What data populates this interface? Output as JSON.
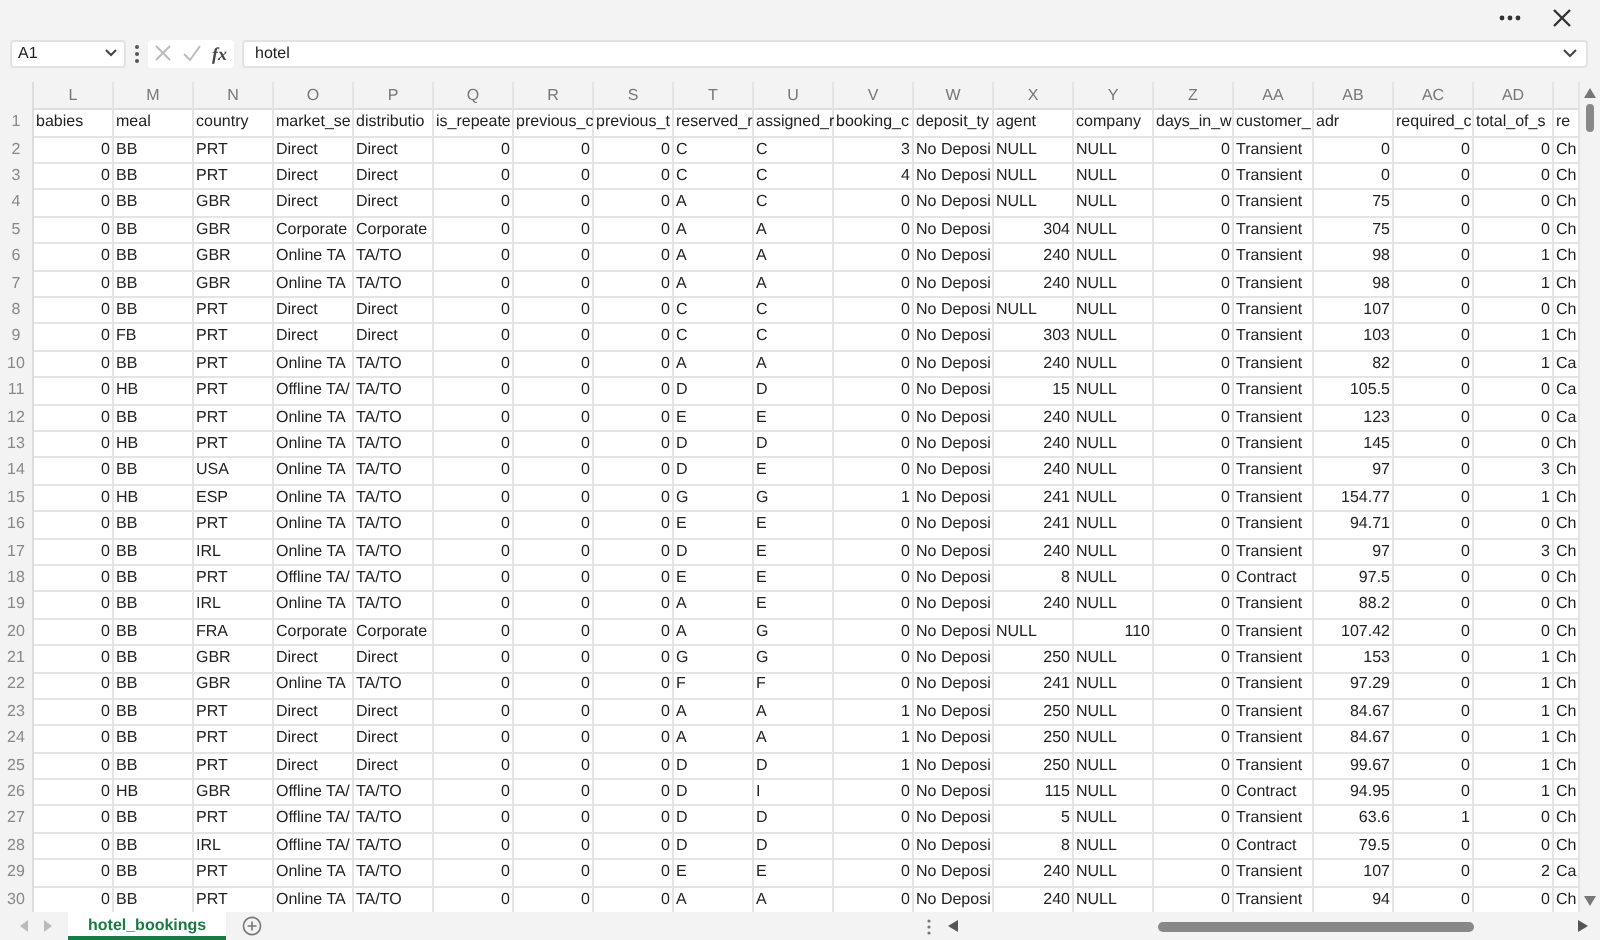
{
  "formula_bar": {
    "name_box": "A1",
    "function_label": "fx",
    "formula": "hotel"
  },
  "sheet": {
    "column_letters": [
      "L",
      "M",
      "N",
      "O",
      "P",
      "Q",
      "R",
      "S",
      "T",
      "U",
      "V",
      "W",
      "X",
      "Y",
      "Z",
      "AA",
      "AB",
      "AC",
      "AD"
    ],
    "rows": [
      {
        "number": "1",
        "cells": [
          "babies",
          "meal",
          "country",
          "market_se",
          "distributio",
          "is_repeate",
          "previous_c",
          "previous_t",
          "reserved_r",
          "assigned_r",
          "booking_c",
          "deposit_ty",
          "agent",
          "company",
          "days_in_w",
          "customer_",
          "adr",
          "required_c",
          "total_of_s",
          "re"
        ]
      },
      {
        "number": "2",
        "cells": [
          "0",
          "BB",
          "PRT",
          "Direct",
          "Direct",
          "0",
          "0",
          "0",
          "C",
          "C",
          "3",
          "No Deposi",
          "NULL",
          "NULL",
          "0",
          "Transient",
          "0",
          "0",
          "0",
          "Ch"
        ]
      },
      {
        "number": "3",
        "cells": [
          "0",
          "BB",
          "PRT",
          "Direct",
          "Direct",
          "0",
          "0",
          "0",
          "C",
          "C",
          "4",
          "No Deposi",
          "NULL",
          "NULL",
          "0",
          "Transient",
          "0",
          "0",
          "0",
          "Ch"
        ]
      },
      {
        "number": "4",
        "cells": [
          "0",
          "BB",
          "GBR",
          "Direct",
          "Direct",
          "0",
          "0",
          "0",
          "A",
          "C",
          "0",
          "No Deposi",
          "NULL",
          "NULL",
          "0",
          "Transient",
          "75",
          "0",
          "0",
          "Ch"
        ]
      },
      {
        "number": "5",
        "cells": [
          "0",
          "BB",
          "GBR",
          "Corporate",
          "Corporate",
          "0",
          "0",
          "0",
          "A",
          "A",
          "0",
          "No Deposi",
          "304",
          "NULL",
          "0",
          "Transient",
          "75",
          "0",
          "0",
          "Ch"
        ]
      },
      {
        "number": "6",
        "cells": [
          "0",
          "BB",
          "GBR",
          "Online TA",
          "TA/TO",
          "0",
          "0",
          "0",
          "A",
          "A",
          "0",
          "No Deposi",
          "240",
          "NULL",
          "0",
          "Transient",
          "98",
          "0",
          "1",
          "Ch"
        ]
      },
      {
        "number": "7",
        "cells": [
          "0",
          "BB",
          "GBR",
          "Online TA",
          "TA/TO",
          "0",
          "0",
          "0",
          "A",
          "A",
          "0",
          "No Deposi",
          "240",
          "NULL",
          "0",
          "Transient",
          "98",
          "0",
          "1",
          "Ch"
        ]
      },
      {
        "number": "8",
        "cells": [
          "0",
          "BB",
          "PRT",
          "Direct",
          "Direct",
          "0",
          "0",
          "0",
          "C",
          "C",
          "0",
          "No Deposi",
          "NULL",
          "NULL",
          "0",
          "Transient",
          "107",
          "0",
          "0",
          "Ch"
        ]
      },
      {
        "number": "9",
        "cells": [
          "0",
          "FB",
          "PRT",
          "Direct",
          "Direct",
          "0",
          "0",
          "0",
          "C",
          "C",
          "0",
          "No Deposi",
          "303",
          "NULL",
          "0",
          "Transient",
          "103",
          "0",
          "1",
          "Ch"
        ]
      },
      {
        "number": "10",
        "cells": [
          "0",
          "BB",
          "PRT",
          "Online TA",
          "TA/TO",
          "0",
          "0",
          "0",
          "A",
          "A",
          "0",
          "No Deposi",
          "240",
          "NULL",
          "0",
          "Transient",
          "82",
          "0",
          "1",
          "Ca"
        ]
      },
      {
        "number": "11",
        "cells": [
          "0",
          "HB",
          "PRT",
          "Offline TA/",
          "TA/TO",
          "0",
          "0",
          "0",
          "D",
          "D",
          "0",
          "No Deposi",
          "15",
          "NULL",
          "0",
          "Transient",
          "105.5",
          "0",
          "0",
          "Ca"
        ]
      },
      {
        "number": "12",
        "cells": [
          "0",
          "BB",
          "PRT",
          "Online TA",
          "TA/TO",
          "0",
          "0",
          "0",
          "E",
          "E",
          "0",
          "No Deposi",
          "240",
          "NULL",
          "0",
          "Transient",
          "123",
          "0",
          "0",
          "Ca"
        ]
      },
      {
        "number": "13",
        "cells": [
          "0",
          "HB",
          "PRT",
          "Online TA",
          "TA/TO",
          "0",
          "0",
          "0",
          "D",
          "D",
          "0",
          "No Deposi",
          "240",
          "NULL",
          "0",
          "Transient",
          "145",
          "0",
          "0",
          "Ch"
        ]
      },
      {
        "number": "14",
        "cells": [
          "0",
          "BB",
          "USA",
          "Online TA",
          "TA/TO",
          "0",
          "0",
          "0",
          "D",
          "E",
          "0",
          "No Deposi",
          "240",
          "NULL",
          "0",
          "Transient",
          "97",
          "0",
          "3",
          "Ch"
        ]
      },
      {
        "number": "15",
        "cells": [
          "0",
          "HB",
          "ESP",
          "Online TA",
          "TA/TO",
          "0",
          "0",
          "0",
          "G",
          "G",
          "1",
          "No Deposi",
          "241",
          "NULL",
          "0",
          "Transient",
          "154.77",
          "0",
          "1",
          "Ch"
        ]
      },
      {
        "number": "16",
        "cells": [
          "0",
          "BB",
          "PRT",
          "Online TA",
          "TA/TO",
          "0",
          "0",
          "0",
          "E",
          "E",
          "0",
          "No Deposi",
          "241",
          "NULL",
          "0",
          "Transient",
          "94.71",
          "0",
          "0",
          "Ch"
        ]
      },
      {
        "number": "17",
        "cells": [
          "0",
          "BB",
          "IRL",
          "Online TA",
          "TA/TO",
          "0",
          "0",
          "0",
          "D",
          "E",
          "0",
          "No Deposi",
          "240",
          "NULL",
          "0",
          "Transient",
          "97",
          "0",
          "3",
          "Ch"
        ]
      },
      {
        "number": "18",
        "cells": [
          "0",
          "BB",
          "PRT",
          "Offline TA/",
          "TA/TO",
          "0",
          "0",
          "0",
          "E",
          "E",
          "0",
          "No Deposi",
          "8",
          "NULL",
          "0",
          "Contract",
          "97.5",
          "0",
          "0",
          "Ch"
        ]
      },
      {
        "number": "19",
        "cells": [
          "0",
          "BB",
          "IRL",
          "Online TA",
          "TA/TO",
          "0",
          "0",
          "0",
          "A",
          "E",
          "0",
          "No Deposi",
          "240",
          "NULL",
          "0",
          "Transient",
          "88.2",
          "0",
          "0",
          "Ch"
        ]
      },
      {
        "number": "20",
        "cells": [
          "0",
          "BB",
          "FRA",
          "Corporate",
          "Corporate",
          "0",
          "0",
          "0",
          "A",
          "G",
          "0",
          "No Deposi",
          "NULL",
          "110",
          "0",
          "Transient",
          "107.42",
          "0",
          "0",
          "Ch"
        ]
      },
      {
        "number": "21",
        "cells": [
          "0",
          "BB",
          "GBR",
          "Direct",
          "Direct",
          "0",
          "0",
          "0",
          "G",
          "G",
          "0",
          "No Deposi",
          "250",
          "NULL",
          "0",
          "Transient",
          "153",
          "0",
          "1",
          "Ch"
        ]
      },
      {
        "number": "22",
        "cells": [
          "0",
          "BB",
          "GBR",
          "Online TA",
          "TA/TO",
          "0",
          "0",
          "0",
          "F",
          "F",
          "0",
          "No Deposi",
          "241",
          "NULL",
          "0",
          "Transient",
          "97.29",
          "0",
          "1",
          "Ch"
        ]
      },
      {
        "number": "23",
        "cells": [
          "0",
          "BB",
          "PRT",
          "Direct",
          "Direct",
          "0",
          "0",
          "0",
          "A",
          "A",
          "1",
          "No Deposi",
          "250",
          "NULL",
          "0",
          "Transient",
          "84.67",
          "0",
          "1",
          "Ch"
        ]
      },
      {
        "number": "24",
        "cells": [
          "0",
          "BB",
          "PRT",
          "Direct",
          "Direct",
          "0",
          "0",
          "0",
          "A",
          "A",
          "1",
          "No Deposi",
          "250",
          "NULL",
          "0",
          "Transient",
          "84.67",
          "0",
          "1",
          "Ch"
        ]
      },
      {
        "number": "25",
        "cells": [
          "0",
          "BB",
          "PRT",
          "Direct",
          "Direct",
          "0",
          "0",
          "0",
          "D",
          "D",
          "1",
          "No Deposi",
          "250",
          "NULL",
          "0",
          "Transient",
          "99.67",
          "0",
          "1",
          "Ch"
        ]
      },
      {
        "number": "26",
        "cells": [
          "0",
          "HB",
          "GBR",
          "Offline TA/",
          "TA/TO",
          "0",
          "0",
          "0",
          "D",
          "I",
          "0",
          "No Deposi",
          "115",
          "NULL",
          "0",
          "Contract",
          "94.95",
          "0",
          "1",
          "Ch"
        ]
      },
      {
        "number": "27",
        "cells": [
          "0",
          "BB",
          "PRT",
          "Offline TA/",
          "TA/TO",
          "0",
          "0",
          "0",
          "D",
          "D",
          "0",
          "No Deposi",
          "5",
          "NULL",
          "0",
          "Transient",
          "63.6",
          "1",
          "0",
          "Ch"
        ]
      },
      {
        "number": "28",
        "cells": [
          "0",
          "BB",
          "IRL",
          "Offline TA/",
          "TA/TO",
          "0",
          "0",
          "0",
          "D",
          "D",
          "0",
          "No Deposi",
          "8",
          "NULL",
          "0",
          "Contract",
          "79.5",
          "0",
          "0",
          "Ch"
        ]
      },
      {
        "number": "29",
        "cells": [
          "0",
          "BB",
          "PRT",
          "Online TA",
          "TA/TO",
          "0",
          "0",
          "0",
          "E",
          "E",
          "0",
          "No Deposi",
          "240",
          "NULL",
          "0",
          "Transient",
          "107",
          "0",
          "2",
          "Ca"
        ]
      },
      {
        "number": "30",
        "cells": [
          "0",
          "BB",
          "PRT",
          "Online TA",
          "TA/TO",
          "0",
          "0",
          "0",
          "A",
          "A",
          "0",
          "No Deposi",
          "240",
          "NULL",
          "0",
          "Transient",
          "94",
          "0",
          "0",
          "Ch"
        ]
      }
    ]
  },
  "sheet_tabs": [
    {
      "label": "hotel_bookings",
      "selected": true
    }
  ]
}
